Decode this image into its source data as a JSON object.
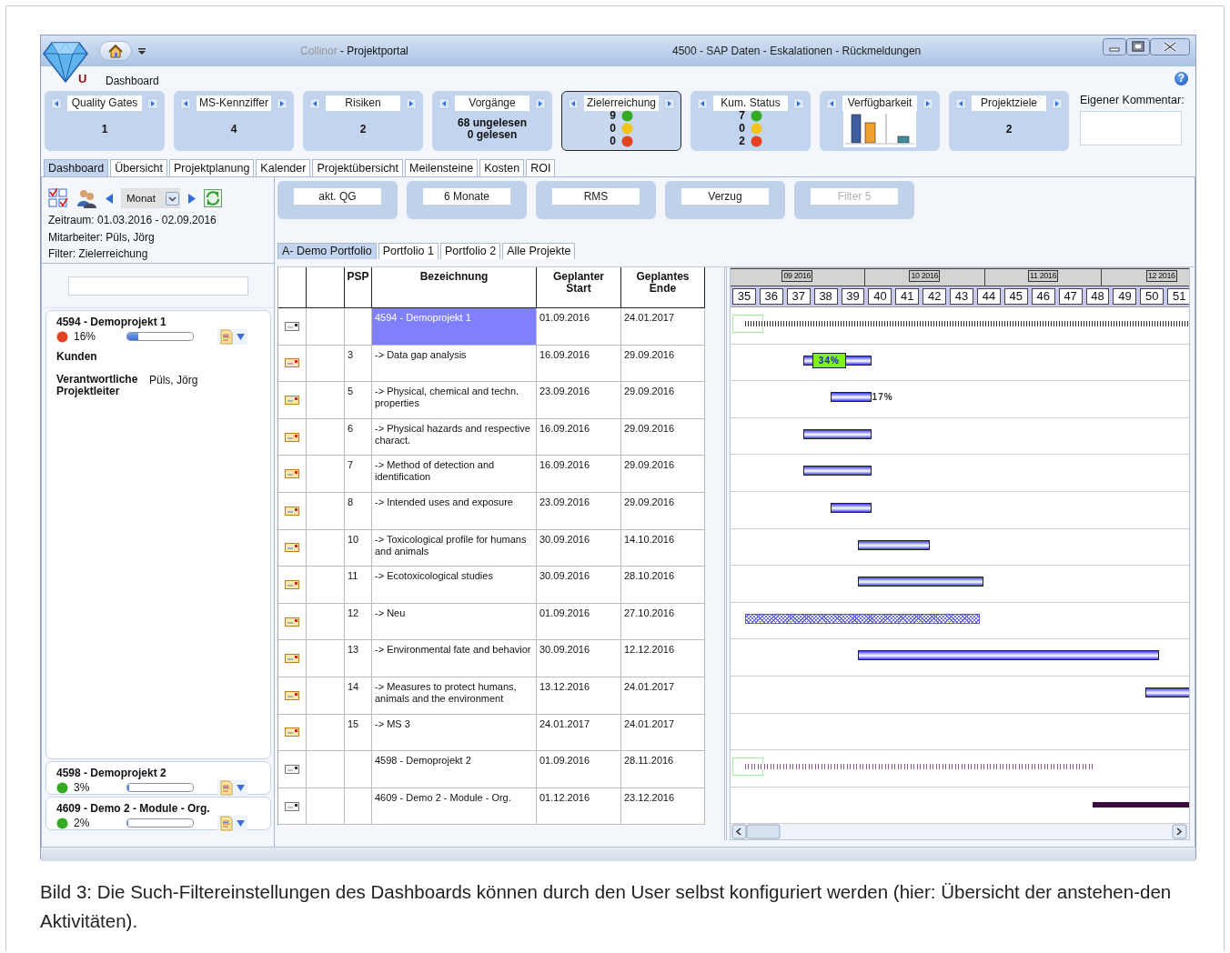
{
  "window": {
    "app_name": "Collinor",
    "title": "- Projektportal",
    "subtitle": "4500 - SAP Daten - Eskalationen - Rückmeldungen",
    "user_initial": "U",
    "ribbon_label": "Dashboard",
    "help": "?"
  },
  "kpis": [
    {
      "kind": "number",
      "title": "Quality Gates",
      "value": "1",
      "selected": false
    },
    {
      "kind": "number",
      "title": "MS-Kennziffer",
      "value": "4",
      "selected": false
    },
    {
      "kind": "number",
      "title": "Risiken",
      "value": "2",
      "selected": false
    },
    {
      "kind": "lines",
      "title": "Vorgänge",
      "lines": [
        "68 ungelesen",
        "0 gelesen"
      ],
      "selected": false
    },
    {
      "kind": "lights",
      "title": "Zielerreichung",
      "selected": true,
      "lights": [
        {
          "count": "9",
          "color": "#33aa22"
        },
        {
          "count": "0",
          "color": "#f2c31b"
        },
        {
          "count": "0",
          "color": "#e5421f"
        }
      ]
    },
    {
      "kind": "lights",
      "title": "Kum. Status",
      "selected": false,
      "lights": [
        {
          "count": "7",
          "color": "#33aa22"
        },
        {
          "count": "0",
          "color": "#f2c31b"
        },
        {
          "count": "2",
          "color": "#e5421f"
        }
      ]
    },
    {
      "kind": "chart",
      "title": "Verfügbarkeit",
      "selected": false
    },
    {
      "kind": "number",
      "title": "Projektziele",
      "value": "2",
      "selected": false
    }
  ],
  "comment": {
    "label": "Eigener Kommentar:"
  },
  "tabs": [
    {
      "label": "Dashboard",
      "selected": true
    },
    {
      "label": "Übersicht",
      "selected": false
    },
    {
      "label": "Projektplanung",
      "selected": false
    },
    {
      "label": "Kalender",
      "selected": false
    },
    {
      "label": "Projektübersicht",
      "selected": false
    },
    {
      "label": "Meilensteine",
      "selected": false
    },
    {
      "label": "Kosten",
      "selected": false
    },
    {
      "label": "ROI",
      "selected": false
    }
  ],
  "toolbar": {
    "period": "Monat"
  },
  "info": [
    "Zeitraum: 01.03.2016 - 02.09.2016",
    "Mitarbeiter:  Püls, Jörg",
    "Filter:  Zielerreichung"
  ],
  "projects": [
    {
      "title": "4594 -  Demoprojekt 1",
      "color": "#e5421f",
      "percent": "16%",
      "level": 0.16,
      "expanded": true,
      "details": [
        {
          "label": "Kunden"
        },
        {
          "label": "Verantwortliche Projektleiter",
          "value": "Püls, Jörg"
        }
      ]
    },
    {
      "title": "4598 - Demoprojekt 2",
      "color": "#33aa22",
      "percent": "3%",
      "level": 0.03,
      "expanded": false
    },
    {
      "title": "4609 - Demo 2 - Module - Org.",
      "color": "#33aa22",
      "percent": "2%",
      "level": 0.02,
      "expanded": false
    }
  ],
  "filters": [
    {
      "label": "akt. QG",
      "disabled": false
    },
    {
      "label": "6 Monate",
      "disabled": false
    },
    {
      "label": "RMS",
      "disabled": false
    },
    {
      "label": "Verzug",
      "disabled": false
    },
    {
      "label": "Filter 5",
      "disabled": true
    }
  ],
  "portfolio_tabs": [
    {
      "label": "A- Demo Portfolio",
      "selected": true
    },
    {
      "label": "Portfolio 1",
      "selected": false
    },
    {
      "label": "Portfolio 2",
      "selected": false
    },
    {
      "label": "Alle Projekte",
      "selected": false
    }
  ],
  "table": {
    "columns": [
      "PSP",
      "Bezeichnung",
      "Geplanter Start",
      "Geplantes Ende"
    ],
    "rows": [
      {
        "kind": "project",
        "name": "4594 -  Demoprojekt 1",
        "start": "01.09.2016",
        "end": "24.01.2017",
        "selected": true,
        "bar": {
          "kind": "summary"
        }
      },
      {
        "kind": "task",
        "psp": "3",
        "name": "-> Data gap analysis",
        "start": "16.09.2016",
        "end": "29.09.2016",
        "selected": false,
        "bar": {
          "kind": "task"
        },
        "bar_label": {
          "text": "34%",
          "kind": "boxed"
        }
      },
      {
        "kind": "task",
        "psp": "5",
        "name": "-> Physical, chemical and techn. properties",
        "start": "23.09.2016",
        "end": "29.09.2016",
        "selected": false,
        "bar": {
          "kind": "task"
        },
        "bar_label": {
          "text": "17%",
          "kind": "beside"
        }
      },
      {
        "kind": "task",
        "psp": "6",
        "name": "-> Physical hazards and respective charact.",
        "start": "16.09.2016",
        "end": "29.09.2016",
        "selected": false,
        "bar": {
          "kind": "task"
        }
      },
      {
        "kind": "task",
        "psp": "7",
        "name": "-> Method of detection and identification",
        "start": "16.09.2016",
        "end": "29.09.2016",
        "selected": false,
        "bar": {
          "kind": "task"
        }
      },
      {
        "kind": "task",
        "psp": "8",
        "name": "-> Intended uses and exposure",
        "start": "23.09.2016",
        "end": "29.09.2016",
        "selected": false,
        "bar": {
          "kind": "task"
        }
      },
      {
        "kind": "task",
        "psp": "10",
        "name": "-> Toxicological profile for humans and animals",
        "start": "30.09.2016",
        "end": "14.10.2016",
        "selected": false,
        "bar": {
          "kind": "task"
        }
      },
      {
        "kind": "task",
        "psp": "11",
        "name": "-> Ecotoxicological studies",
        "start": "30.09.2016",
        "end": "28.10.2016",
        "selected": false,
        "bar": {
          "kind": "task"
        }
      },
      {
        "kind": "task",
        "psp": "12",
        "name": "-> Neu",
        "start": "01.09.2016",
        "end": "27.10.2016",
        "selected": false,
        "bar": {
          "kind": "hatched"
        }
      },
      {
        "kind": "task",
        "psp": "13",
        "name": "-> Environmental fate and behavior",
        "start": "30.09.2016",
        "end": "12.12.2016",
        "selected": false,
        "bar": {
          "kind": "task"
        }
      },
      {
        "kind": "task",
        "psp": "14",
        "name": "-> Measures to protect humans, animals and the environment",
        "start": "13.12.2016",
        "end": "24.01.2017",
        "selected": false,
        "bar": {
          "kind": "task"
        }
      },
      {
        "kind": "task",
        "psp": "15",
        "name": "-> MS 3",
        "start": "24.01.2017",
        "end": "24.01.2017",
        "selected": false
      },
      {
        "kind": "project",
        "name": "4598 - Demoprojekt 2",
        "start": "01.09.2016",
        "end": "28.11.2016",
        "selected": false,
        "bar": {
          "kind": "dotted"
        }
      },
      {
        "kind": "project",
        "name": "4609 - Demo 2 - Module - Org.",
        "start": "01.12.2016",
        "end": "23.12.2016",
        "selected": false,
        "bar": {
          "kind": "dark"
        }
      }
    ]
  },
  "gantt": {
    "months": [
      "09 2016",
      "10 2016",
      "11 2016",
      "12 2016"
    ],
    "weeks": [
      "35",
      "36",
      "37",
      "38",
      "39",
      "40",
      "41",
      "42",
      "43",
      "44",
      "45",
      "46",
      "47",
      "48",
      "49",
      "50",
      "51"
    ]
  },
  "caption": "Bild 3: Die Such-Filtereinstellungen des Dashboards können durch den User selbst konfiguriert werden (hier: Übersicht der anstehen-den Aktivitäten)."
}
